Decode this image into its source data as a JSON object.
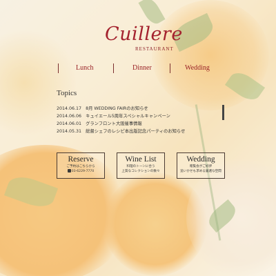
{
  "logo": {
    "name": "Cuillere",
    "subtitle": "RESTAURANT"
  },
  "nav": {
    "items": [
      {
        "label": "Lunch"
      },
      {
        "label": "Dinner"
      },
      {
        "label": "Wedding"
      }
    ]
  },
  "topics": {
    "title": "Topics",
    "items": [
      {
        "date": "2014.06.17",
        "text": "8月 WEDDING FAIRのお知らせ"
      },
      {
        "date": "2014.06.06",
        "text": "キュイエール5周年スペシャルキャンペーン"
      },
      {
        "date": "2014.06.01",
        "text": "グランフロント大阪催事情報"
      },
      {
        "date": "2014.05.31",
        "text": "総督シェフのレシピ本出版記念パーティのお知らせ"
      }
    ]
  },
  "buttons": {
    "reserve": {
      "title": "Reserve",
      "line1": "ご予約はこちらから",
      "phone_icon": "phone-icon",
      "line2": "03-6229-7770"
    },
    "wine_list": {
      "title": "Wine List",
      "line1": "料理のトーンに合う",
      "line2": "上質なコレクションの数々"
    },
    "wedding": {
      "title": "Wedding",
      "line1": "贈覧会がご好評",
      "line2": "追いかせも求める厳選な空間"
    }
  },
  "colors": {
    "brand": "#a4222e",
    "nav_text": "#9a2226",
    "body_text": "#333333",
    "button_border": "#4a3a32"
  }
}
